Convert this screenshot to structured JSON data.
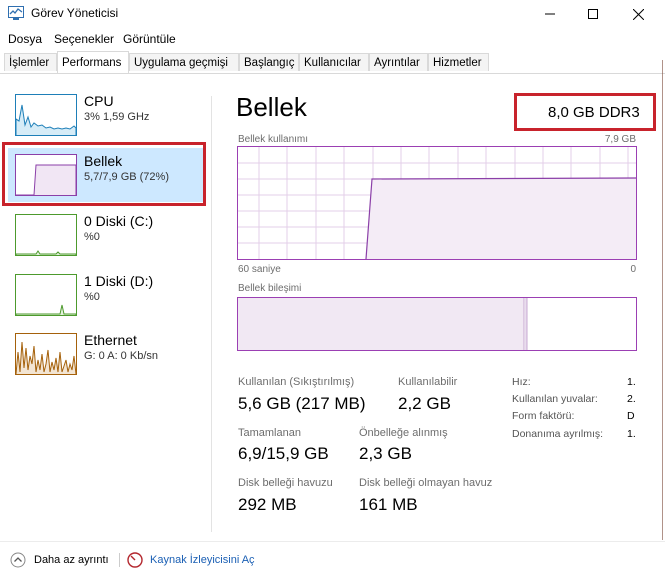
{
  "window": {
    "title": "Görev Yöneticisi"
  },
  "menu": [
    "Dosya",
    "Seçenekler",
    "Görüntüle"
  ],
  "tabs": [
    "İşlemler",
    "Performans",
    "Uygulama geçmişi",
    "Başlangıç",
    "Kullanıcılar",
    "Ayrıntılar",
    "Hizmetler"
  ],
  "active_tab": "Performans",
  "sidebar": {
    "items": [
      {
        "title": "CPU",
        "sub": "3% 1,59 GHz"
      },
      {
        "title": "Bellek",
        "sub": "5,7/7,9 GB (72%)"
      },
      {
        "title": "0 Diski (C:)",
        "sub": "%0"
      },
      {
        "title": "1 Diski (D:)",
        "sub": "%0"
      },
      {
        "title": "Ethernet",
        "sub": "G: 0 A: 0 Kb/sn"
      }
    ],
    "selected": "Bellek"
  },
  "main": {
    "title": "Bellek",
    "spec": "8,0 GB DDR3",
    "usage_graph": {
      "label": "Bellek kullanımı",
      "max": "7,9 GB",
      "x_left": "60 saniye",
      "x_right": "0"
    },
    "composition_label": "Bellek bileşimi",
    "stats": [
      {
        "label": "Kullanılan (Sıkıştırılmış)",
        "value": "5,6 GB (217 MB)"
      },
      {
        "label": "Kullanılabilir",
        "value": "2,2 GB"
      },
      {
        "label": "Tamamlanan",
        "value": "6,9/15,9 GB"
      },
      {
        "label": "Önbelleğe alınmış",
        "value": "2,3 GB"
      },
      {
        "label": "Disk belleği havuzu",
        "value": "292 MB"
      },
      {
        "label": "Disk belleği olmayan havuz",
        "value": "161 MB"
      }
    ],
    "hardware": [
      {
        "label": "Hız:",
        "value": "1."
      },
      {
        "label": "Kullanılan yuvalar:",
        "value": "2."
      },
      {
        "label": "Form faktörü:",
        "value": "D"
      },
      {
        "label": "Donanıma ayrılmış:",
        "value": "1."
      }
    ]
  },
  "footer": {
    "less_details": "Daha az ayrıntı",
    "resource_monitor": "Kaynak İzleyicisini Aç"
  },
  "colors": {
    "memory": "#8b3fa8",
    "cpu": "#1e7fb8",
    "disk": "#4d9a2d",
    "ethernet": "#a5610b",
    "highlight": "#c8232c",
    "selected_bg": "#cde8ff"
  }
}
